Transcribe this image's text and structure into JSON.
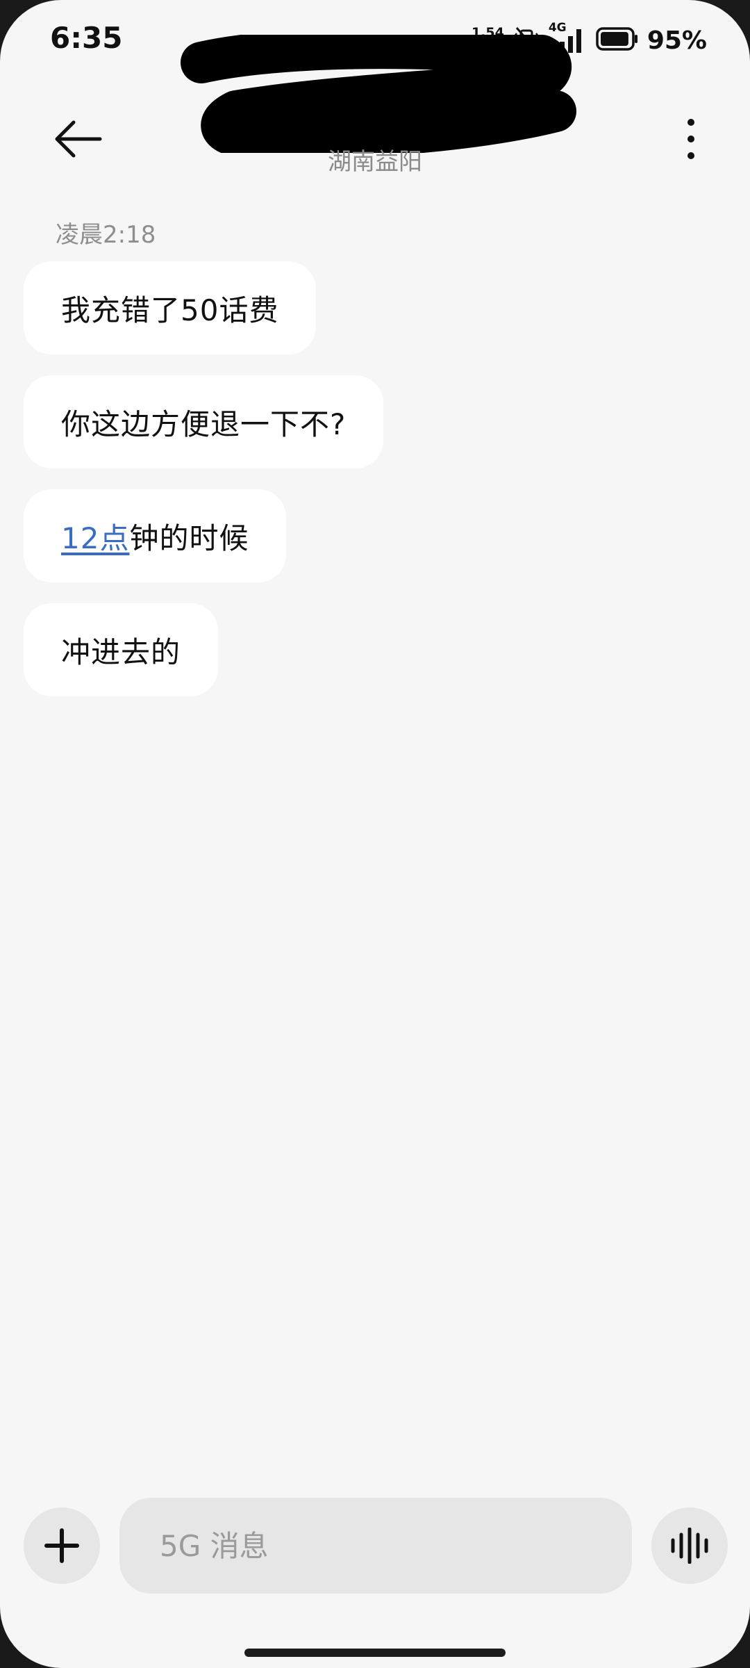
{
  "status_bar": {
    "time": "6:35",
    "network_speed": "1.54",
    "network_type": "4G",
    "battery_percent": "95%",
    "battery_level": 0.95
  },
  "header": {
    "subtitle": "湖南益阳"
  },
  "conversation": {
    "timestamp": "凌晨2:18",
    "messages": [
      {
        "text": "我充错了50话费"
      },
      {
        "text": "你这边方便退一下不?"
      },
      {
        "link": "12点",
        "text": "钟的时候"
      },
      {
        "text": "冲进去的"
      }
    ]
  },
  "input_bar": {
    "placeholder": "5G 消息"
  }
}
